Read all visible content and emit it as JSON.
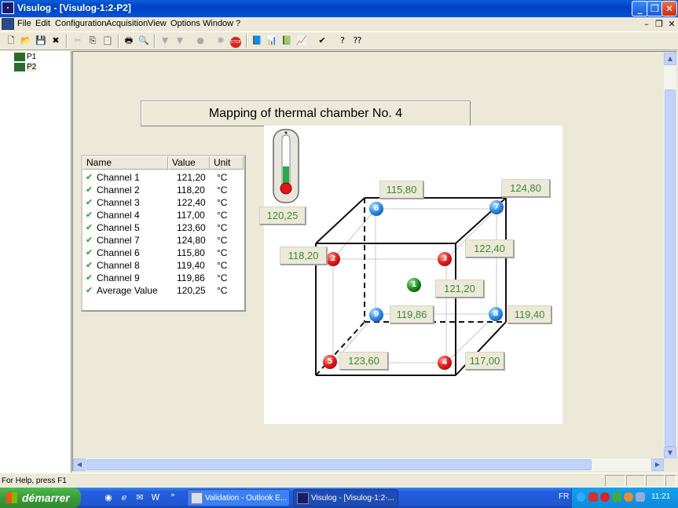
{
  "window": {
    "app_icon": "Visulog",
    "title": "Visulog - [Visulog-1:2-P2]"
  },
  "menu": [
    "File",
    "Edit",
    "Configuration",
    "Acquisition",
    "View",
    "Options",
    "Window",
    "?"
  ],
  "tree": [
    "P1",
    "P2"
  ],
  "heading": "Mapping of thermal chamber No. 4",
  "list": {
    "headers": [
      "Name",
      "Value",
      "Unit"
    ],
    "rows": [
      {
        "name": "Channel 1",
        "value": "121,20",
        "unit": "°C"
      },
      {
        "name": "Channel 2",
        "value": "118,20",
        "unit": "°C"
      },
      {
        "name": "Channel 3",
        "value": "122,40",
        "unit": "°C"
      },
      {
        "name": "Channel 4",
        "value": "117,00",
        "unit": "°C"
      },
      {
        "name": "Channel 5",
        "value": "123,60",
        "unit": "°C"
      },
      {
        "name": "Channel 7",
        "value": "124,80",
        "unit": "°C"
      },
      {
        "name": "Channel 6",
        "value": "115,80",
        "unit": "°C"
      },
      {
        "name": "Channel 8",
        "value": "119,40",
        "unit": "°C"
      },
      {
        "name": "Channel 9",
        "value": "119,86",
        "unit": "°C"
      },
      {
        "name": "Average Value",
        "value": "120,25",
        "unit": "°C"
      }
    ]
  },
  "thermometer": {
    "value": "120,25",
    "level": 0.45
  },
  "probes": [
    {
      "id": "1",
      "color": "#1a8a1a",
      "value": "121,20"
    },
    {
      "id": "2",
      "color": "#e01818",
      "value": "118,20"
    },
    {
      "id": "3",
      "color": "#e01818",
      "value": "122,40"
    },
    {
      "id": "4",
      "color": "#e01818",
      "value": "117,00"
    },
    {
      "id": "5",
      "color": "#e01818",
      "value": "123,60"
    },
    {
      "id": "6",
      "color": "#2a8ae8",
      "value": "115,80"
    },
    {
      "id": "7",
      "color": "#2a8ae8",
      "value": "124,80"
    },
    {
      "id": "8",
      "color": "#2a8ae8",
      "value": "119,40"
    },
    {
      "id": "9",
      "color": "#2a8ae8",
      "value": "119,86"
    }
  ],
  "status": {
    "help": "For Help, press F1"
  },
  "taskbar": {
    "start": "démarrer",
    "tasks": [
      "Validation - Outlook E...",
      "Visulog - [Visulog-1:2-..."
    ],
    "lang": "FR",
    "clock": "11:21"
  },
  "colors": {
    "title_blue": "#0042c4",
    "value_green": "#3a8a3a",
    "start_green": "#3a9a3a"
  }
}
